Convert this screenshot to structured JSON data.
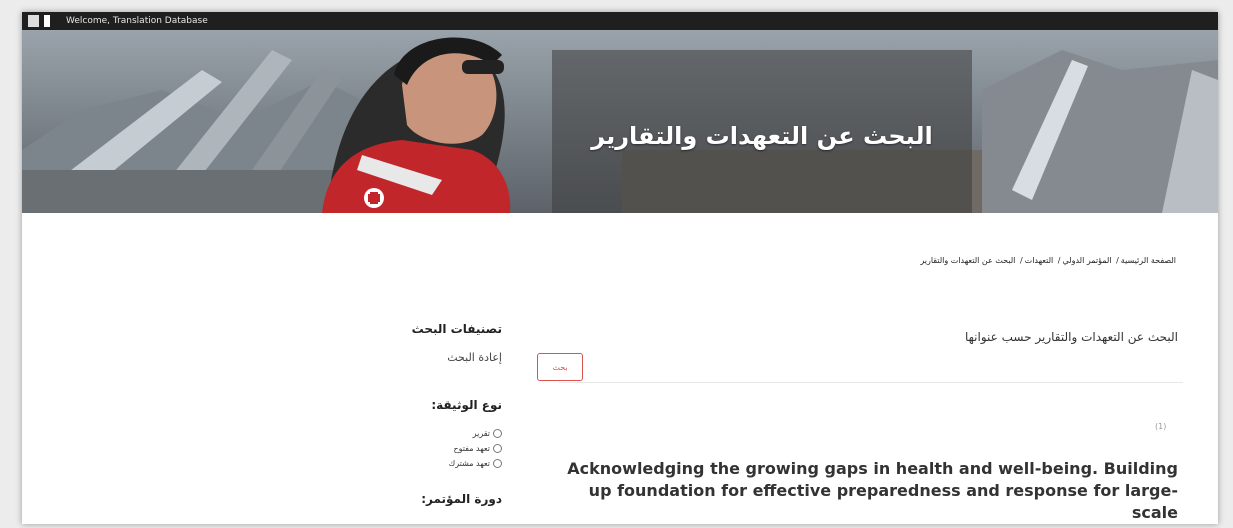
{
  "topbar": {
    "welcome_text": "Welcome, Translation Database"
  },
  "banner": {
    "title": "البحث عن التعهدات والتقارير"
  },
  "breadcrumb": [
    "الصفحة الرئيسية",
    "المؤتمر الدولي",
    "التعهدات",
    "البحث عن التعهدات والتقارير"
  ],
  "search": {
    "label": "البحث عن التعهدات والتقارير حسب عنوانها",
    "placeholder": "",
    "button_label": "بحث"
  },
  "results": {
    "count_label": "(1)",
    "first_title": "Acknowledging the growing gaps in health and well-being. Building up foundation for effective preparedness and response for large-scale"
  },
  "sidebar": {
    "filters_heading": "تصنيفات البحث",
    "reset_label": "إعادة البحث",
    "doc_type_heading": "نوع الوثيقة:",
    "doc_type_options": [
      "تقرير",
      "تعهد مفتوح",
      "تعهد مشترك"
    ],
    "session_heading": "دورة المؤتمر:"
  },
  "colors": {
    "accent_red": "#d9534f",
    "topbar": "#1f1f1f"
  }
}
